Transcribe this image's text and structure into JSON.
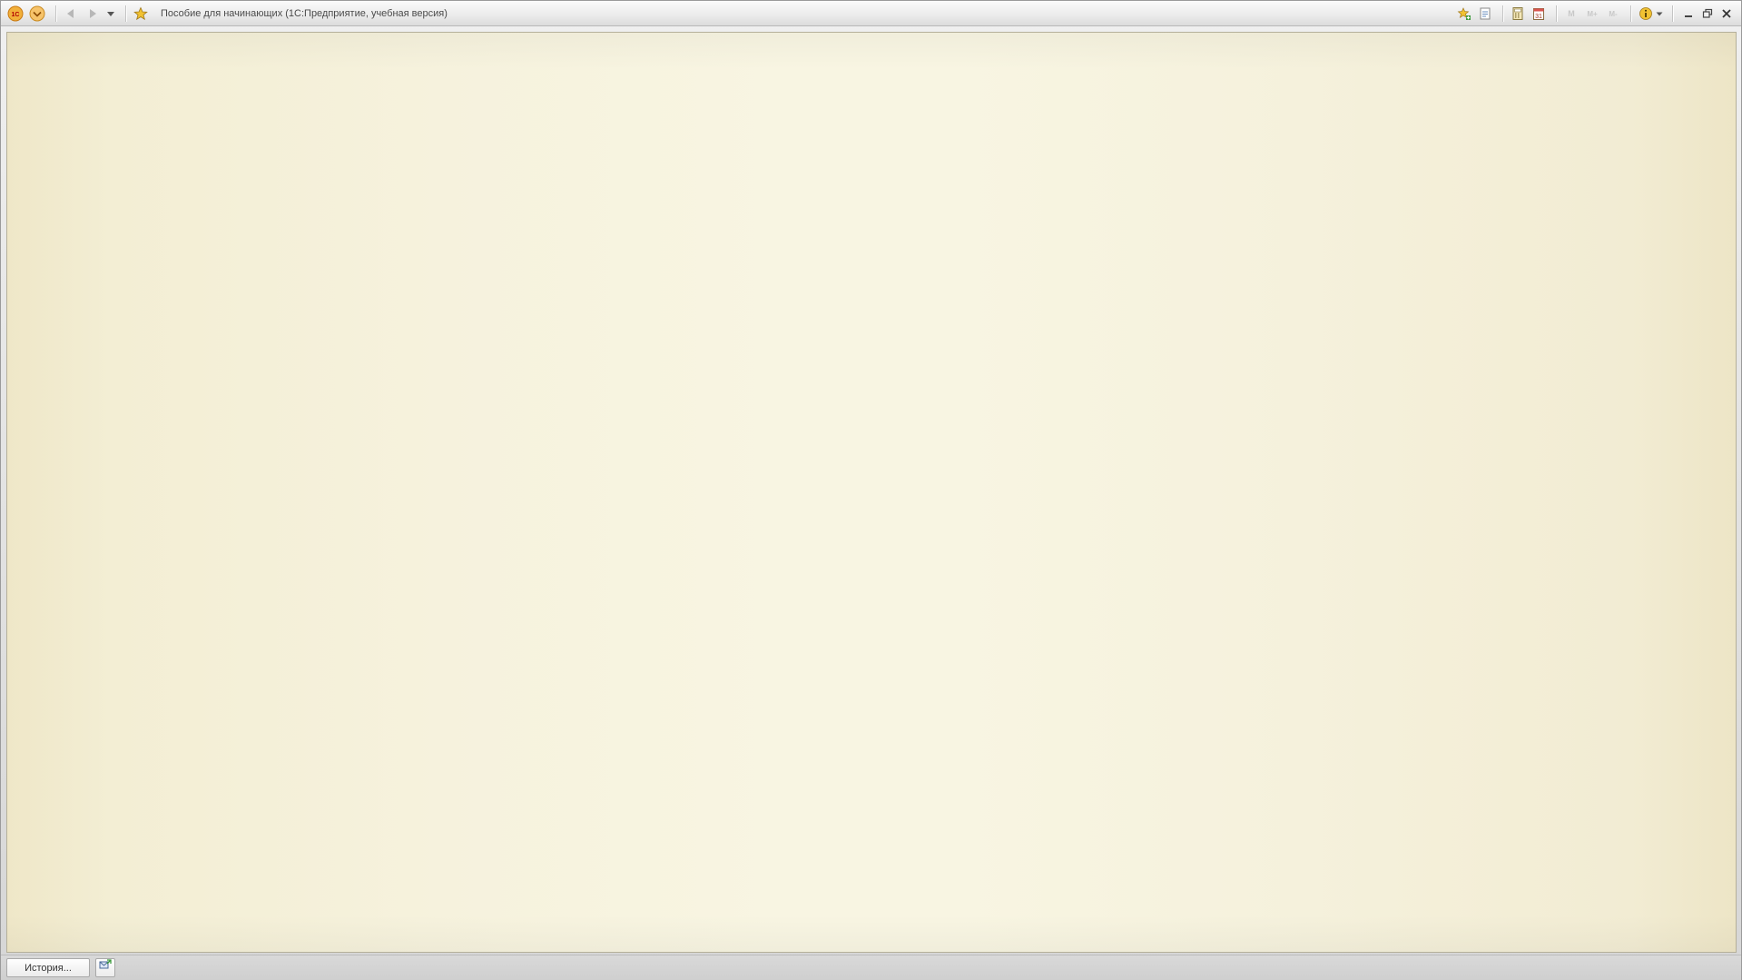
{
  "window": {
    "title": "Пособие для начинающих  (1С:Предприятие, учебная версия)"
  },
  "titlebar": {
    "left_icons": [
      "1c-logo-icon",
      "main-menu-icon",
      "back-arrow-icon",
      "forward-arrow-icon",
      "history-dropdown-icon",
      "favorites-star-icon"
    ],
    "right_icons": [
      "add-to-favorites-icon",
      "copy-link-icon",
      "calculator-icon",
      "calendar-icon",
      "m-icon",
      "m-plus-icon",
      "m-minus-icon",
      "info-icon",
      "info-dropdown-icon"
    ],
    "window_controls": [
      "minimize-icon",
      "restore-icon",
      "close-icon"
    ]
  },
  "statusbar": {
    "history_label": "История...",
    "messages_icon": "messages-icon"
  },
  "colors": {
    "workarea_center": "#f8f5e2",
    "workarea_edge": "#efe7c8",
    "logo_orange": "#f0a020",
    "star_yellow": "#f1c232"
  }
}
